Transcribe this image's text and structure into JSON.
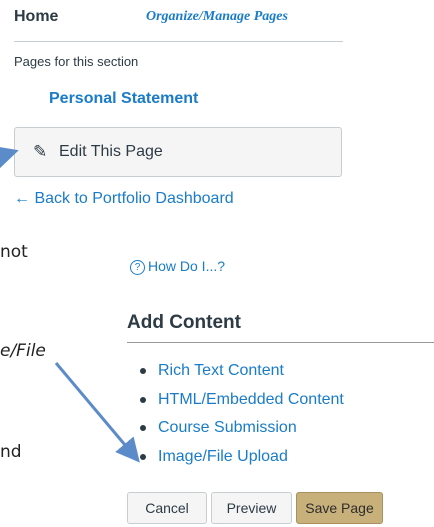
{
  "home_label": "Home",
  "organize_link": "Organize/Manage Pages",
  "pages_for_section": "Pages for this section",
  "current_page": "Personal Statement",
  "edit_button": "Edit This Page",
  "back_link": "← Back to Portfolio Dashboard",
  "how_do_i": "How Do I...?",
  "add_content": {
    "title": "Add Content",
    "items": [
      "Rich Text Content",
      "HTML/Embedded Content",
      "Course Submission",
      "Image/File Upload"
    ]
  },
  "buttons": {
    "cancel": "Cancel",
    "preview": "Preview",
    "save": "Save Page"
  },
  "fragments": {
    "not": "not",
    "file": "e/File",
    "nd": "nd"
  },
  "colors": {
    "link": "#1a7cc8",
    "text": "#2d3b45",
    "save_bg": "#c8b07a",
    "arrow": "#5b8bc9"
  }
}
